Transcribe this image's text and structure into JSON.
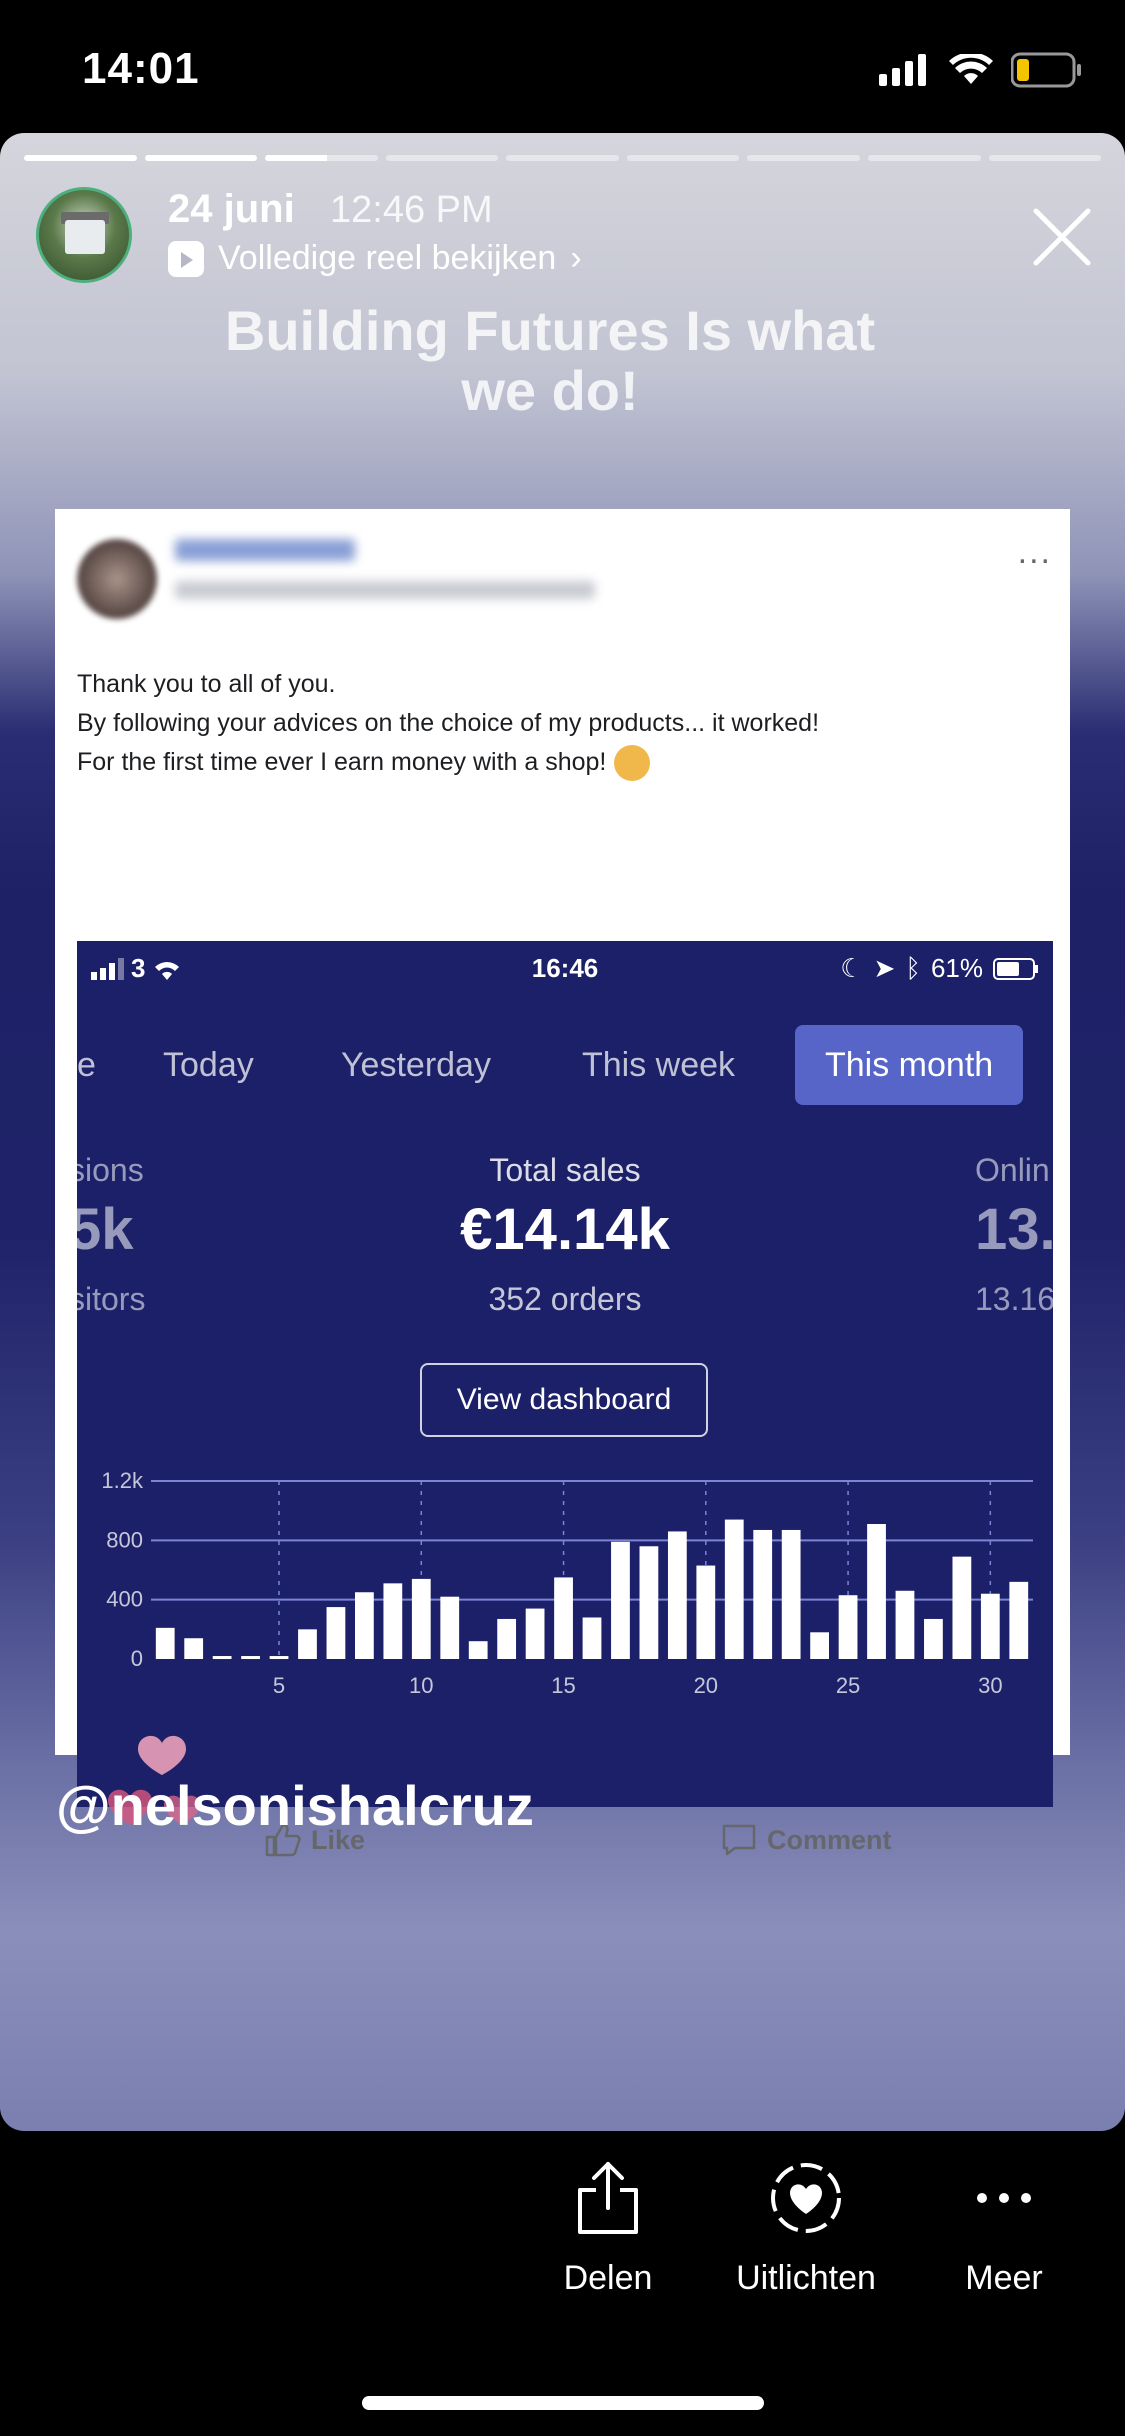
{
  "status_bar": {
    "time": "14:01"
  },
  "story": {
    "progress": {
      "segments": 9,
      "active_index": 2,
      "active_fraction": 0.55
    },
    "date": "24 juni",
    "time": "12:46 PM",
    "reel_link": "Volledige reel bekijken",
    "headline_line1": "Building Futures Is what",
    "headline_line2": "we do!",
    "mention": "@nelsonishalcruz"
  },
  "post": {
    "text_line1": "Thank you to all of you.",
    "text_line2": "By following your advices on the choice of my products... it worked!",
    "text_line3": "For the first time ever I earn money with a shop!",
    "like_label": "Like",
    "comment_label": "Comment",
    "more_label": "..."
  },
  "screenshot": {
    "carrier": "3",
    "time": "16:46",
    "battery": "61%",
    "tabs": [
      "e",
      "Today",
      "Yesterday",
      "This week",
      "This month"
    ],
    "active_tab": "This month",
    "kpi_left": {
      "label": "sions",
      "value": "5k",
      "sub": "sitors"
    },
    "kpi_center": {
      "label": "Total sales",
      "value": "€14.14k",
      "sub": "352 orders"
    },
    "kpi_right": {
      "label": "Onlin",
      "value": "13.",
      "sub": "13.16"
    },
    "view_button": "View dashboard"
  },
  "chart_data": {
    "type": "bar",
    "x": [
      1,
      2,
      3,
      4,
      5,
      6,
      7,
      8,
      9,
      10,
      11,
      12,
      13,
      14,
      15,
      16,
      17,
      18,
      19,
      20,
      21,
      22,
      23,
      24,
      25,
      26,
      27,
      28,
      29,
      30,
      31
    ],
    "values": [
      210,
      140,
      20,
      20,
      20,
      200,
      350,
      450,
      510,
      540,
      420,
      120,
      270,
      340,
      550,
      280,
      790,
      760,
      860,
      630,
      940,
      870,
      870,
      180,
      430,
      910,
      460,
      270,
      690,
      440,
      520
    ],
    "x_ticks": [
      "5",
      "10",
      "15",
      "20",
      "25",
      "30"
    ],
    "y_ticks": [
      "0",
      "400",
      "800",
      "1.2k"
    ],
    "ylim": [
      0,
      1200
    ],
    "grid": true,
    "colors": {
      "bar": "#ffffff",
      "grid": "#7c84d8",
      "background": "#1b2068"
    }
  },
  "bottom_actions": [
    {
      "label": "Delen",
      "icon": "share-icon"
    },
    {
      "label": "Uitlichten",
      "icon": "highlight-icon"
    },
    {
      "label": "Meer",
      "icon": "more-icon"
    }
  ]
}
